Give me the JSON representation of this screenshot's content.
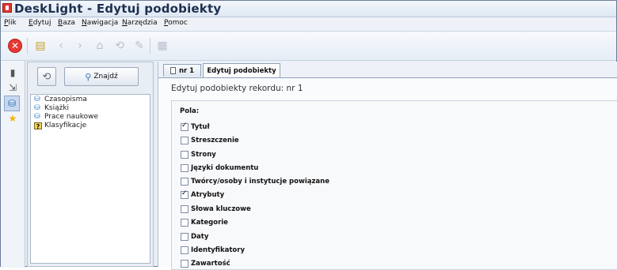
{
  "window": {
    "title": "DeskLight - Edytuj podobiekty"
  },
  "menu": [
    {
      "label": "Plik",
      "u": "P",
      "rest": "lik"
    },
    {
      "label": "Edytuj",
      "u": "E",
      "rest": "dytuj"
    },
    {
      "label": "Baza",
      "u": "B",
      "rest": "aza"
    },
    {
      "label": "Nawigacja",
      "u": "N",
      "rest": "awigacja"
    },
    {
      "label": "Narzędzia",
      "u": "N",
      "rest": "arzędzia"
    },
    {
      "label": "Pomoc",
      "u": "P",
      "rest": "omoc"
    }
  ],
  "toolbar": {
    "close_glyph": "✕",
    "docs_glyph": "▤",
    "back_glyph": "‹",
    "forward_glyph": "›",
    "home_glyph": "⌂",
    "sync_glyph": "⟲",
    "edit_glyph": "✎",
    "note_glyph": "▦"
  },
  "leftstrip": {
    "icons": [
      "book-icon",
      "arrow-icon",
      "database-icon",
      "star-icon"
    ],
    "glyphs": [
      "▮",
      "⇲",
      "⛁",
      "★"
    ]
  },
  "left_panel": {
    "refresh_glyph": "⟲",
    "find_label": "Znajdź",
    "find_glyph": "⚲",
    "tree": [
      {
        "label": "Czasopisma",
        "glyph": "⛁",
        "kind": "db"
      },
      {
        "label": "Książki",
        "glyph": "⛁",
        "kind": "db"
      },
      {
        "label": "Prace naukowe",
        "glyph": "⛁",
        "kind": "db"
      },
      {
        "label": "Klasyfikacje",
        "glyph": "?",
        "kind": "q"
      }
    ]
  },
  "tabs": [
    {
      "label": "nr 1",
      "active": false
    },
    {
      "label": "Edytuj podobiekty",
      "active": true
    }
  ],
  "panel": {
    "heading": "Edytuj podobiekty rekordu: nr 1",
    "fields_title": "Pola:",
    "fields": [
      {
        "label": "Tytuł",
        "checked": true
      },
      {
        "label": "Streszczenie",
        "checked": false
      },
      {
        "label": "Strony",
        "checked": false
      },
      {
        "label": "Języki dokumentu",
        "checked": false
      },
      {
        "label": "Twórcy/osoby i instytucje powiązane",
        "checked": false
      },
      {
        "label": "Atrybuty",
        "checked": true
      },
      {
        "label": "Słowa kluczowe",
        "checked": false
      },
      {
        "label": "Kategorie",
        "checked": false
      },
      {
        "label": "Daty",
        "checked": false
      },
      {
        "label": "Identyfikatory",
        "checked": false
      },
      {
        "label": "Zawartość",
        "checked": false
      }
    ]
  }
}
